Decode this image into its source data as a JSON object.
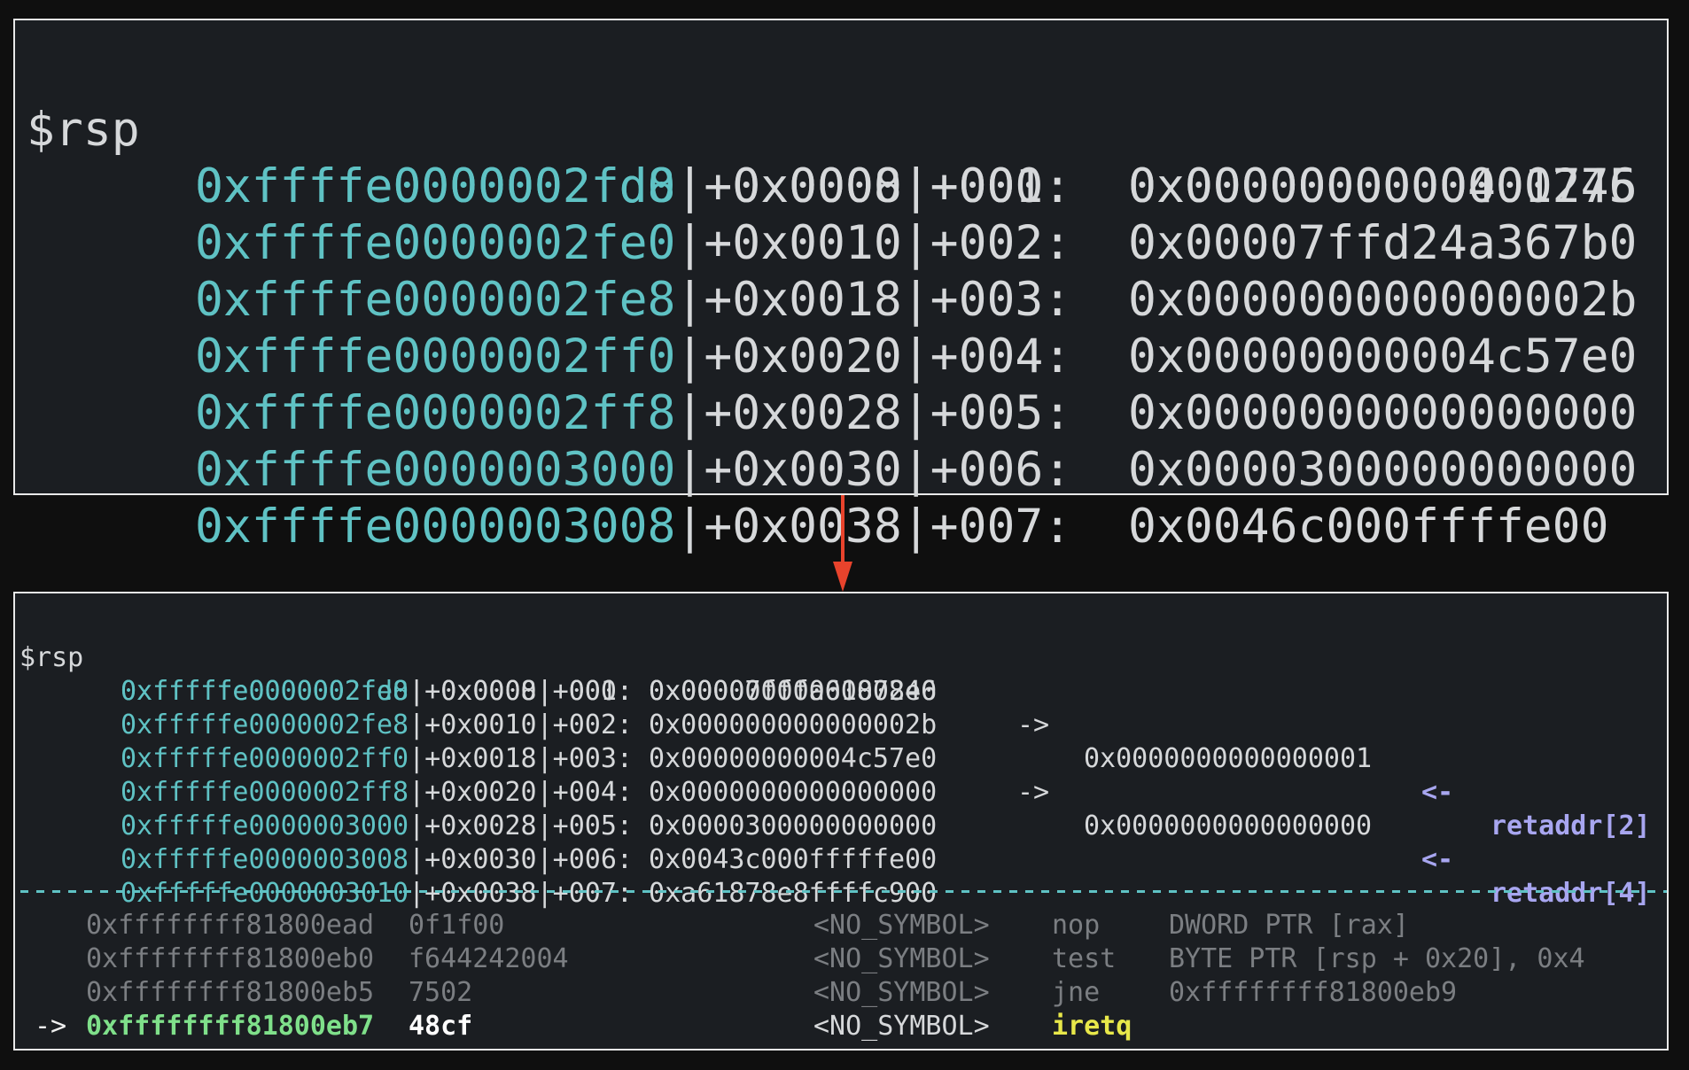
{
  "top_stack": {
    "register": "$rsp",
    "rows": [
      {
        "addr": "0xffffe0000002fd0",
        "off": "+0x0000",
        "idx": "+000:",
        "val": "0x0000000000401775"
      },
      {
        "addr": "0xffffe0000002fd8",
        "off": "+0x0008",
        "idx": "+001:",
        "val": "0x0000000000000246"
      },
      {
        "addr": "0xffffe0000002fe0",
        "off": "+0x0010",
        "idx": "+002:",
        "val": "0x00007ffd24a367b0"
      },
      {
        "addr": "0xffffe0000002fe8",
        "off": "+0x0018",
        "idx": "+003:",
        "val": "0x000000000000002b"
      },
      {
        "addr": "0xffffe0000002ff0",
        "off": "+0x0020",
        "idx": "+004:",
        "val": "0x00000000004c57e0"
      },
      {
        "addr": "0xffffe0000002ff8",
        "off": "+0x0028",
        "idx": "+005:",
        "val": "0x0000000000000000"
      },
      {
        "addr": "0xffffe0000003000",
        "off": "+0x0030",
        "idx": "+006:",
        "val": "0x0000300000000000"
      },
      {
        "addr": "0xffffe0000003008",
        "off": "+0x0038",
        "idx": "+007:",
        "val": "0x0046c000ffffe00"
      }
    ]
  },
  "bottom_stack": {
    "register": "$rsp",
    "rows": [
      {
        "addr": "0xfffffe0000002fd8",
        "off": "+0x0000",
        "idx": "+000:",
        "val": "0x0000000000000246",
        "arrow": "",
        "deref": "",
        "larrow": "",
        "ret": ""
      },
      {
        "addr": "0xfffffe0000002fe0",
        "off": "+0x0008",
        "idx": "+001:",
        "val": "0x00007fffa61878e0",
        "arrow": "->",
        "deref": "0x0000000000000001",
        "larrow": "<-",
        "ret": "retaddr[2]"
      },
      {
        "addr": "0xfffffe0000002fe8",
        "off": "+0x0010",
        "idx": "+002:",
        "val": "0x000000000000002b",
        "arrow": "",
        "deref": "",
        "larrow": "",
        "ret": ""
      },
      {
        "addr": "0xfffffe0000002ff0",
        "off": "+0x0018",
        "idx": "+003:",
        "val": "0x00000000004c57e0",
        "arrow": "->",
        "deref": "0x0000000000000000",
        "larrow": "<-",
        "ret": "retaddr[4]"
      },
      {
        "addr": "0xfffffe0000002ff8",
        "off": "+0x0020",
        "idx": "+004:",
        "val": "0x0000000000000000",
        "arrow": "",
        "deref": "",
        "larrow": "",
        "ret": ""
      },
      {
        "addr": "0xfffffe0000003000",
        "off": "+0x0028",
        "idx": "+005:",
        "val": "0x0000300000000000",
        "arrow": "",
        "deref": "",
        "larrow": "",
        "ret": ""
      },
      {
        "addr": "0xfffffe0000003008",
        "off": "+0x0030",
        "idx": "+006:",
        "val": "0x0043c000fffffe00",
        "arrow": "",
        "deref": "",
        "larrow": "",
        "ret": ""
      },
      {
        "addr": "0xfffffe0000003010",
        "off": "+0x0038",
        "idx": "+007:",
        "val": "0xa61878e8ffffc900",
        "arrow": "",
        "deref": "",
        "larrow": "",
        "ret": ""
      }
    ]
  },
  "disassembly": [
    {
      "ptr": "",
      "addr": "0xffffffff81800ead",
      "bytes": "0f1f00",
      "sym": "<NO_SYMBOL>",
      "mnemonic": "nop",
      "operands": "DWORD PTR [rax]"
    },
    {
      "ptr": "",
      "addr": "0xffffffff81800eb0",
      "bytes": "f644242004",
      "sym": "<NO_SYMBOL>",
      "mnemonic": "test",
      "operands": "BYTE PTR [rsp + 0x20], 0x4"
    },
    {
      "ptr": "",
      "addr": "0xffffffff81800eb5",
      "bytes": "7502",
      "sym": "<NO_SYMBOL>",
      "mnemonic": "jne",
      "operands": "0xffffffff81800eb9"
    },
    {
      "ptr": "->",
      "addr": "0xffffffff81800eb7",
      "bytes": "48cf",
      "sym": "<NO_SYMBOL>",
      "mnemonic": "iretq",
      "operands": ""
    }
  ],
  "colors": {
    "address": "#5fc2c4",
    "retaddr": "#a8a6f0",
    "current_addr": "#7fe08a",
    "current_mnemonic": "#e8e84a",
    "connector": "#e8432c"
  }
}
